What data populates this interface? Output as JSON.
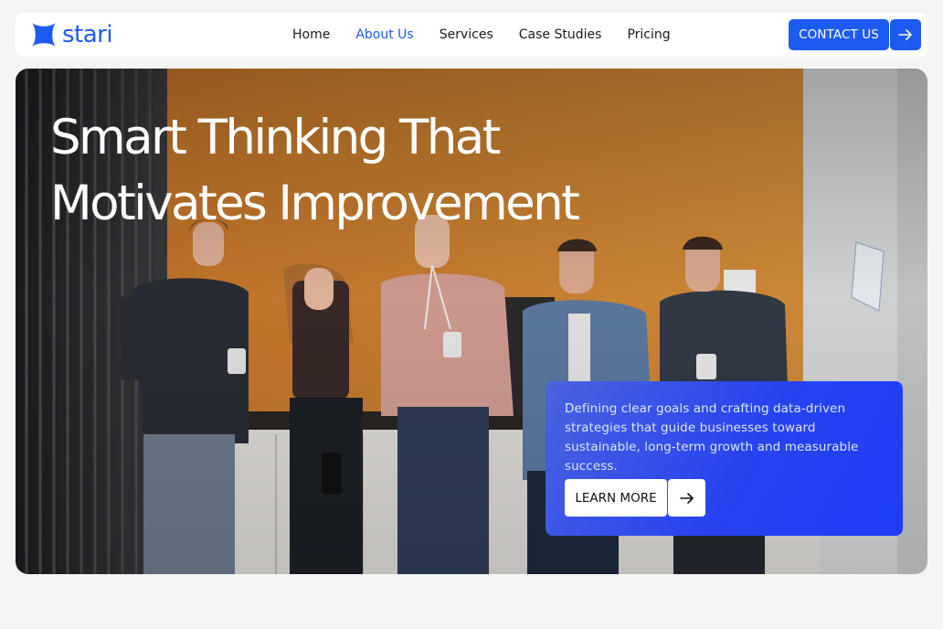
{
  "brand": {
    "name": "stari",
    "color": "#1d5bf0"
  },
  "nav": {
    "items": [
      {
        "label": "Home",
        "active": false
      },
      {
        "label": "About Us",
        "active": true
      },
      {
        "label": "Services",
        "active": false
      },
      {
        "label": "Case Studies",
        "active": false
      },
      {
        "label": "Pricing",
        "active": false
      }
    ],
    "contact_label": "CONTACT US",
    "contact_icon": "arrow-right-icon"
  },
  "hero": {
    "title_line1": "Smart Thinking That",
    "title_line2": "Motivates Improvement",
    "card": {
      "text": "Defining clear goals and crafting data-driven strategies that guide businesses toward sustainable, long-term growth and measurable success.",
      "button_label": "LEARN MORE",
      "button_icon": "arrow-right-icon"
    }
  },
  "colors": {
    "accent": "#1d5bf0",
    "card": "#2743f0",
    "wall": "#c9852f"
  }
}
